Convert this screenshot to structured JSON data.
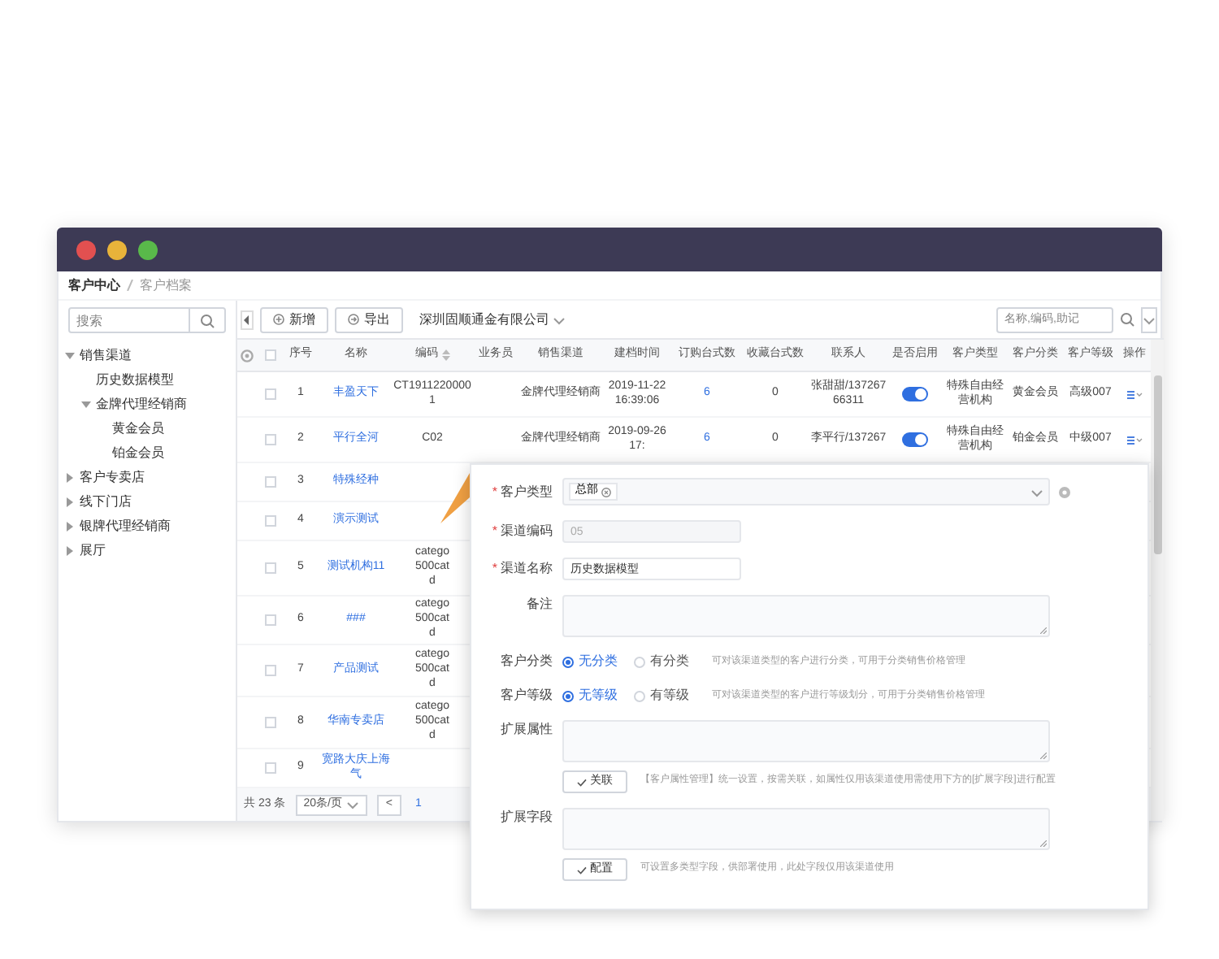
{
  "breadcrumb": [
    "客户中心",
    "客户档案"
  ],
  "sidebar": {
    "search": {
      "placeholder": "搜索"
    },
    "tree": [
      {
        "label": "销售渠道",
        "expanded": true,
        "children": [
          {
            "label": "历史数据模型"
          },
          {
            "label": "金牌代理经销商",
            "expanded": true,
            "children": [
              {
                "label": "黄金会员"
              },
              {
                "label": "铂金会员"
              }
            ]
          }
        ]
      },
      {
        "label": "客户专卖店",
        "expanded": false
      },
      {
        "label": "线下门店",
        "expanded": false
      },
      {
        "label": "银牌代理经销商",
        "expanded": false
      },
      {
        "label": "展厅",
        "expanded": false
      }
    ]
  },
  "toolbar": {
    "buttons": [
      {
        "label": "新增",
        "kind": "add"
      },
      {
        "label": "导出",
        "kind": "export"
      }
    ],
    "company": "深圳固顺通金有限公司",
    "search": {
      "placeholder": "名称,编码,助记"
    }
  },
  "table": {
    "select_all_checked": false,
    "columns": [
      {
        "label": "序号",
        "kind": "plain"
      },
      {
        "label": "名称",
        "kind": "plain"
      },
      {
        "label": "编码",
        "kind": "sortable"
      },
      {
        "label": "业务员",
        "kind": "plain"
      },
      {
        "label": "销售渠道",
        "kind": "plain"
      },
      {
        "label": "建档时间",
        "kind": "plain"
      },
      {
        "label": "订购台式数",
        "kind": "plain"
      },
      {
        "label": "收藏台式数",
        "kind": "plain"
      },
      {
        "label": "联系人",
        "kind": "plain"
      },
      {
        "label": "是否启用",
        "kind": "plain"
      },
      {
        "label": "客户类型",
        "kind": "plain"
      },
      {
        "label": "客户分类",
        "kind": "plain"
      },
      {
        "label": "客户等级",
        "kind": "plain"
      },
      {
        "label": "操作",
        "kind": "plain"
      }
    ],
    "rows": [
      {
        "checked": false,
        "index": "1",
        "name": "丰盈天下",
        "code": "CT19112200001",
        "channel": "金牌代理经销商",
        "created": "2019-11-22 16:39:06",
        "ordered": "6",
        "favorited": "0",
        "contact": "张甜甜/13726766311",
        "enabled": true,
        "customer_type": "特殊自由经营机构",
        "category": "黄金会员",
        "level": "高级007"
      },
      {
        "checked": false,
        "index": "2",
        "name": "平行全河",
        "code": "C02",
        "channel": "金牌代理经销商",
        "created": "2019-09-26 17:",
        "ordered": "6",
        "favorited": "0",
        "contact": "李平行/137267",
        "enabled": true,
        "customer_type": "特殊自由经营机构",
        "category": "铂金会员",
        "level": "中级007"
      },
      {
        "checked": false,
        "index": "3",
        "name": "特殊经种"
      },
      {
        "checked": false,
        "index": "4",
        "name": "演示测试"
      },
      {
        "checked": false,
        "index": "5",
        "name": "测试机构11",
        "code": "catego\n500cat\nd"
      },
      {
        "checked": false,
        "index": "6",
        "name": "###",
        "code": "catego\n500cat\nd"
      },
      {
        "checked": false,
        "index": "7",
        "name": "产品测试",
        "code": "catego\n500cat\nd"
      },
      {
        "checked": false,
        "index": "8",
        "name": "华南专卖店",
        "code": "catego\n500cat\nd"
      },
      {
        "checked": false,
        "index": "9",
        "name": "宽路大庆上海气"
      }
    ]
  },
  "pagination": {
    "total": "共 23 条",
    "page_size": "20条/页",
    "prev": "<",
    "page": "1"
  },
  "dialog": {
    "fields": [
      {
        "kind": "select",
        "required_mark": "*",
        "label": "客户类型",
        "tag": "总部"
      },
      {
        "kind": "input",
        "required_mark": "*",
        "label": "渠道编码",
        "value": "05",
        "disabled": true
      },
      {
        "kind": "input",
        "required_mark": "*",
        "label": "渠道名称",
        "value": "历史数据模型",
        "disabled": false
      },
      {
        "kind": "textarea",
        "label": "备注"
      },
      {
        "kind": "radio",
        "label": "客户分类",
        "options": [
          {
            "label": "无分类",
            "selected": true
          },
          {
            "label": "有分类",
            "selected": false
          }
        ],
        "hint": "可对该渠道类型的客户进行分类，可用于分类销售价格管理"
      },
      {
        "kind": "radio",
        "label": "客户等级",
        "options": [
          {
            "label": "无等级",
            "selected": true
          },
          {
            "label": "有等级",
            "selected": false
          }
        ],
        "hint": "可对该渠道类型的客户进行等级划分，可用于分类销售价格管理"
      },
      {
        "kind": "textarea",
        "label": "扩展属性",
        "button": "关联",
        "hint": "【客户属性管理】统一设置，按需关联，如属性仅用该渠道使用需使用下方的[扩展字段]进行配置"
      },
      {
        "kind": "textarea",
        "label": "扩展字段",
        "button": "配置",
        "hint": "可设置多类型字段，供部署使用，此处字段仅用该渠道使用"
      }
    ]
  }
}
